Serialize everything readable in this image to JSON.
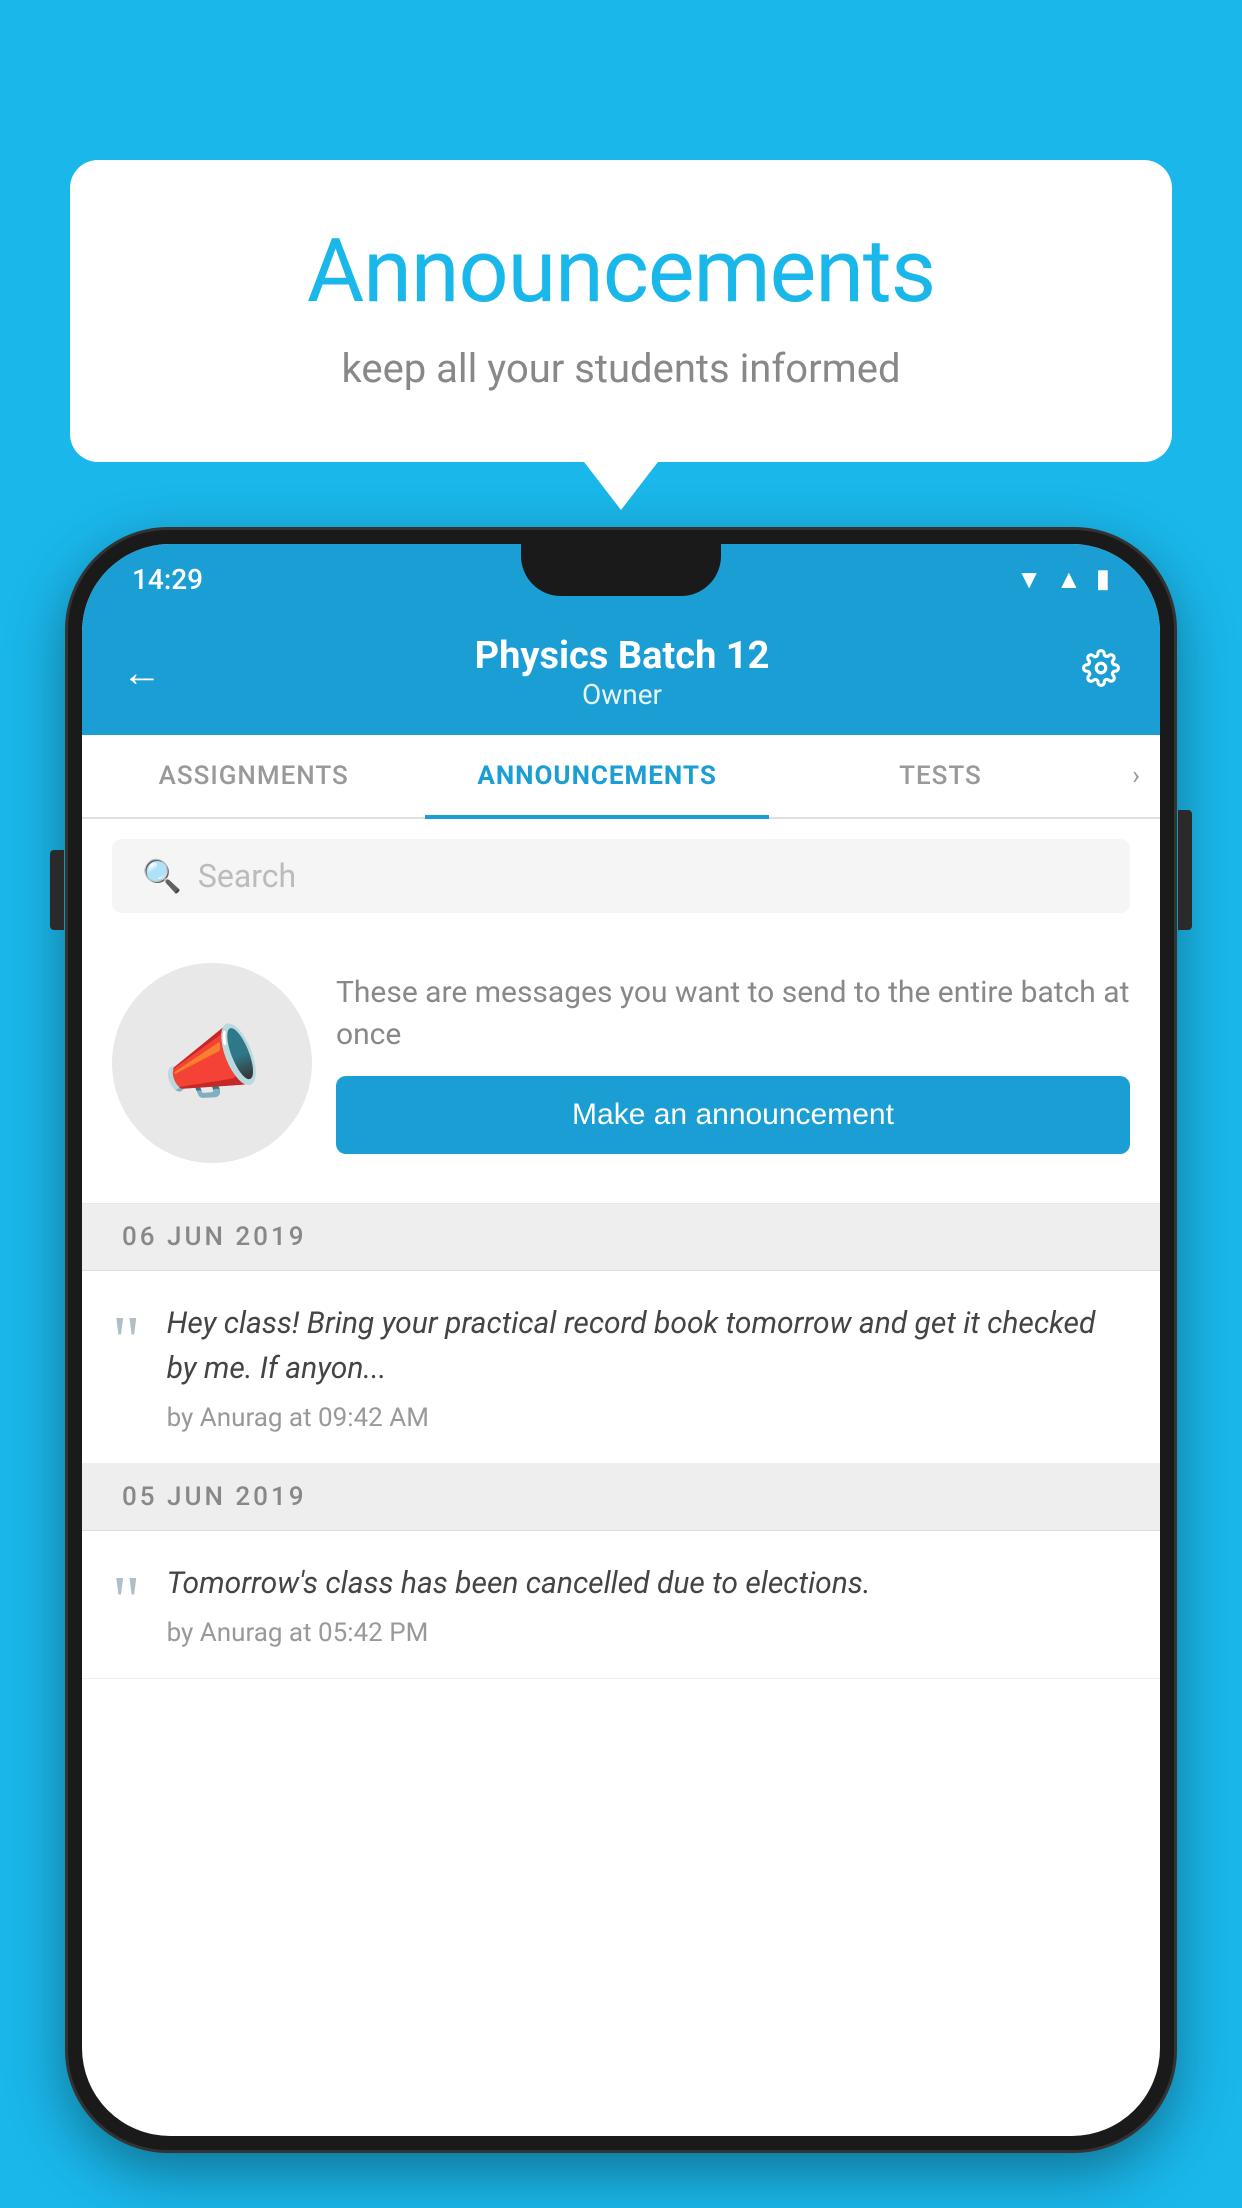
{
  "bubble": {
    "title": "Announcements",
    "subtitle": "keep all your students informed"
  },
  "statusBar": {
    "time": "14:29"
  },
  "header": {
    "title": "Physics Batch 12",
    "subtitle": "Owner",
    "backLabel": "←",
    "settingsLabel": "⚙"
  },
  "tabs": [
    {
      "label": "ASSIGNMENTS",
      "active": false
    },
    {
      "label": "ANNOUNCEMENTS",
      "active": true
    },
    {
      "label": "TESTS",
      "active": false
    }
  ],
  "search": {
    "placeholder": "Search"
  },
  "promo": {
    "description": "These are messages you want to send to the entire batch at once",
    "buttonLabel": "Make an announcement"
  },
  "announcements": [
    {
      "date": "06  JUN  2019",
      "text": "Hey class! Bring your practical record book tomorrow and get it checked by me. If anyon...",
      "meta": "by Anurag at 09:42 AM"
    },
    {
      "date": "05  JUN  2019",
      "text": "Tomorrow's class has been cancelled due to elections.",
      "meta": "by Anurag at 05:42 PM"
    }
  ]
}
